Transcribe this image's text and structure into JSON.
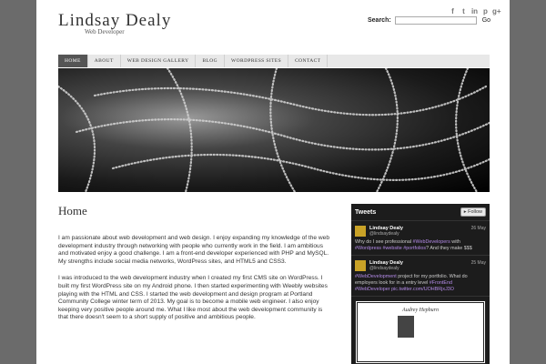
{
  "site": {
    "title": "Lindsay Dealy",
    "tagline": "Web Developer"
  },
  "search": {
    "label": "Search:",
    "placeholder": "",
    "button": "Go"
  },
  "social_icons": [
    "facebook-icon",
    "twitter-icon",
    "linkedin-icon",
    "pinterest-icon",
    "google-plus-icon"
  ],
  "nav": [
    {
      "label": "HOME",
      "active": true
    },
    {
      "label": "ABOUT",
      "active": false
    },
    {
      "label": "WEB DESIGN GALLERY",
      "active": false
    },
    {
      "label": "BLOG",
      "active": false
    },
    {
      "label": "WORDPRESS SITES",
      "active": false
    },
    {
      "label": "CONTACT",
      "active": false
    }
  ],
  "main": {
    "title": "Home",
    "paragraphs": [
      "I am passionate about web development and web design. I enjoy expanding my knowledge of the web development industry through networking with people who currently work in the field. I am ambitious and motivated enjoy a good challenge. I am a front-end developer experienced with PHP and MySQL. My strengths include social media networks, WordPress sites, and HTML5 and CSS3.",
      "I was introduced to the web development industry when I created my first CMS site on WordPress. I built my first WordPress site on my Android phone. I then started experimenting with Weebly websites playing with the HTML and CSS. I started the web development and design program at Portland Community College winter term of 2013. My goal is to become a mobile web engineer. I also enjoy keeping very positive people around me. What I like most about the web development community is that there doesn't seem to a short supply of positive and ambitious people."
    ]
  },
  "tweets": {
    "title": "Tweets",
    "follow_label": "Follow",
    "items": [
      {
        "name": "Lindsay Dealy",
        "handle": "@lindsaydealy",
        "date": "26 May",
        "text_parts": [
          "Why do I see professional ",
          "#WebDevelopers",
          " with ",
          "#Wordpress",
          " ",
          "#website",
          " ",
          "#portfolios",
          "? And they make $$$"
        ]
      },
      {
        "name": "Lindsay Dealy",
        "handle": "@lindsaydealy",
        "date": "25 May",
        "text_parts": [
          "#WebDevelopment",
          " project for my portfolio. What do employers look for in a entry level ",
          "#FrontEnd",
          " ",
          "#WebDeveloper",
          " ",
          "pic.twitter.com/UOHBRjxJ3O"
        ]
      }
    ],
    "card_title": "Audrey Hepburn"
  },
  "colors": {
    "nav_active": "#555555",
    "tweet_tag": "#b48be8",
    "widget_bg": "#1c1c1c",
    "page_bg": "#6b6b6b"
  }
}
